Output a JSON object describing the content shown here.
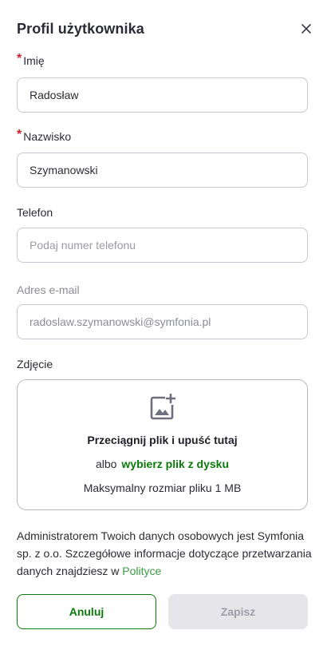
{
  "header": {
    "title": "Profil użytkownika",
    "close_icon": "close-icon"
  },
  "form": {
    "first_name": {
      "label": "Imię",
      "required": true,
      "value": "Radosław"
    },
    "last_name": {
      "label": "Nazwisko",
      "required": true,
      "value": "Szymanowski"
    },
    "phone": {
      "label": "Telefon",
      "placeholder": "Podaj numer telefonu"
    },
    "email": {
      "label": "Adres e-mail",
      "value": "radoslaw.szymanowski@symfonia.pl",
      "disabled": true
    },
    "photo": {
      "label": "Zdjęcie",
      "icon": "add-image-icon",
      "drop_title": "Przeciągnij plik i upuść tutaj",
      "or_text": "albo",
      "browse_link": "wybierz plik z dysku",
      "max_size": "Maksymalny rozmiar pliku 1 MB"
    }
  },
  "privacy": {
    "text": "Administratorem Twoich danych osobowych jest Symfonia sp. z o.o. Szczegółowe informacje dotyczące przetwarzania danych znajdziesz w",
    "link": "Polityce"
  },
  "footer": {
    "cancel_label": "Anuluj",
    "save_label": "Zapisz"
  },
  "colors": {
    "accent_green": "#0b7a0b",
    "required_red": "#d0202e",
    "link_green": "#3a9a45",
    "disabled_button_bg": "#e6e6ea"
  }
}
